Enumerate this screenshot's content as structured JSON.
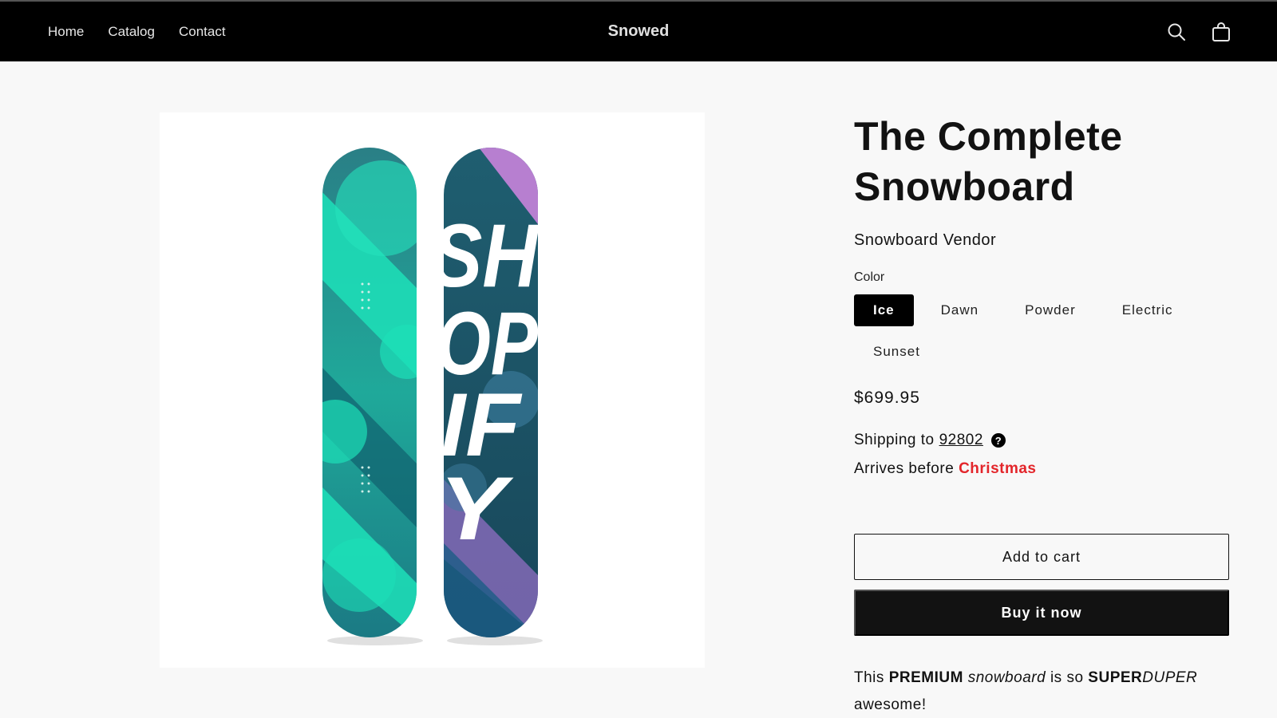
{
  "nav": {
    "home": "Home",
    "catalog": "Catalog",
    "contact": "Contact"
  },
  "brand": "Snowed",
  "header_icons": {
    "search": "search-icon",
    "cart": "cart-icon"
  },
  "product": {
    "title": "The Complete Snowboard",
    "vendor": "Snowboard Vendor",
    "color_label": "Color",
    "colors": [
      "Ice",
      "Dawn",
      "Powder",
      "Electric",
      "Sunset"
    ],
    "selected_color": "Ice",
    "price": "$699.95",
    "shipping_prefix": "Shipping to",
    "zip": "92802",
    "help_icon": "?",
    "arrives_prefix": "Arrives before",
    "arrives_highlight": "Christmas",
    "add_to_cart": "Add to cart",
    "buy_now": "Buy it now",
    "desc": {
      "t1": "This",
      "t2": "PREMIUM",
      "t3": "snowboard",
      "t4": "is so",
      "t5": "SUPER",
      "t6": "DUPER",
      "t7": "awesome!"
    },
    "board_graphic": "SHOPIFY"
  },
  "colors": {
    "accent_red": "#e3252a",
    "header_bg": "#000000",
    "board_teal": "#1de0b8",
    "board_purple": "#b77fd0"
  }
}
